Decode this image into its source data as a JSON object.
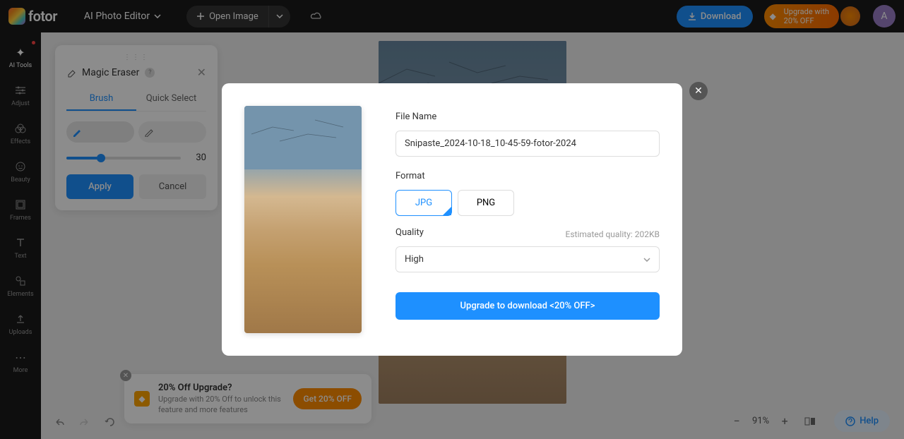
{
  "header": {
    "logo_text": "fotor",
    "title": "AI Photo Editor",
    "open_image": "Open Image",
    "download": "Download",
    "upgrade_line1": "Upgrade with",
    "upgrade_line2": "20% OFF",
    "avatar_initial": "A"
  },
  "sidebar": {
    "items": [
      "AI Tools",
      "Adjust",
      "Effects",
      "Beauty",
      "Frames",
      "Text",
      "Elements",
      "Uploads",
      "More"
    ]
  },
  "panel": {
    "title": "Magic Eraser",
    "tab_brush": "Brush",
    "tab_quick": "Quick Select",
    "slider_value": "30",
    "apply": "Apply",
    "cancel": "Cancel"
  },
  "modal": {
    "file_name_label": "File Name",
    "file_name_value": "Snipaste_2024-10-18_10-45-59-fotor-2024",
    "format_label": "Format",
    "format_jpg": "JPG",
    "format_png": "PNG",
    "quality_label": "Quality",
    "quality_estimate": "Estimated quality: 202KB",
    "quality_value": "High",
    "upgrade_btn": "Upgrade to download <20% OFF>"
  },
  "promo": {
    "title": "20% Off Upgrade?",
    "desc": "Upgrade with 20% Off to unlock this feature and more features",
    "btn": "Get 20% OFF"
  },
  "zoom": {
    "value": "91%",
    "help": "Help"
  }
}
